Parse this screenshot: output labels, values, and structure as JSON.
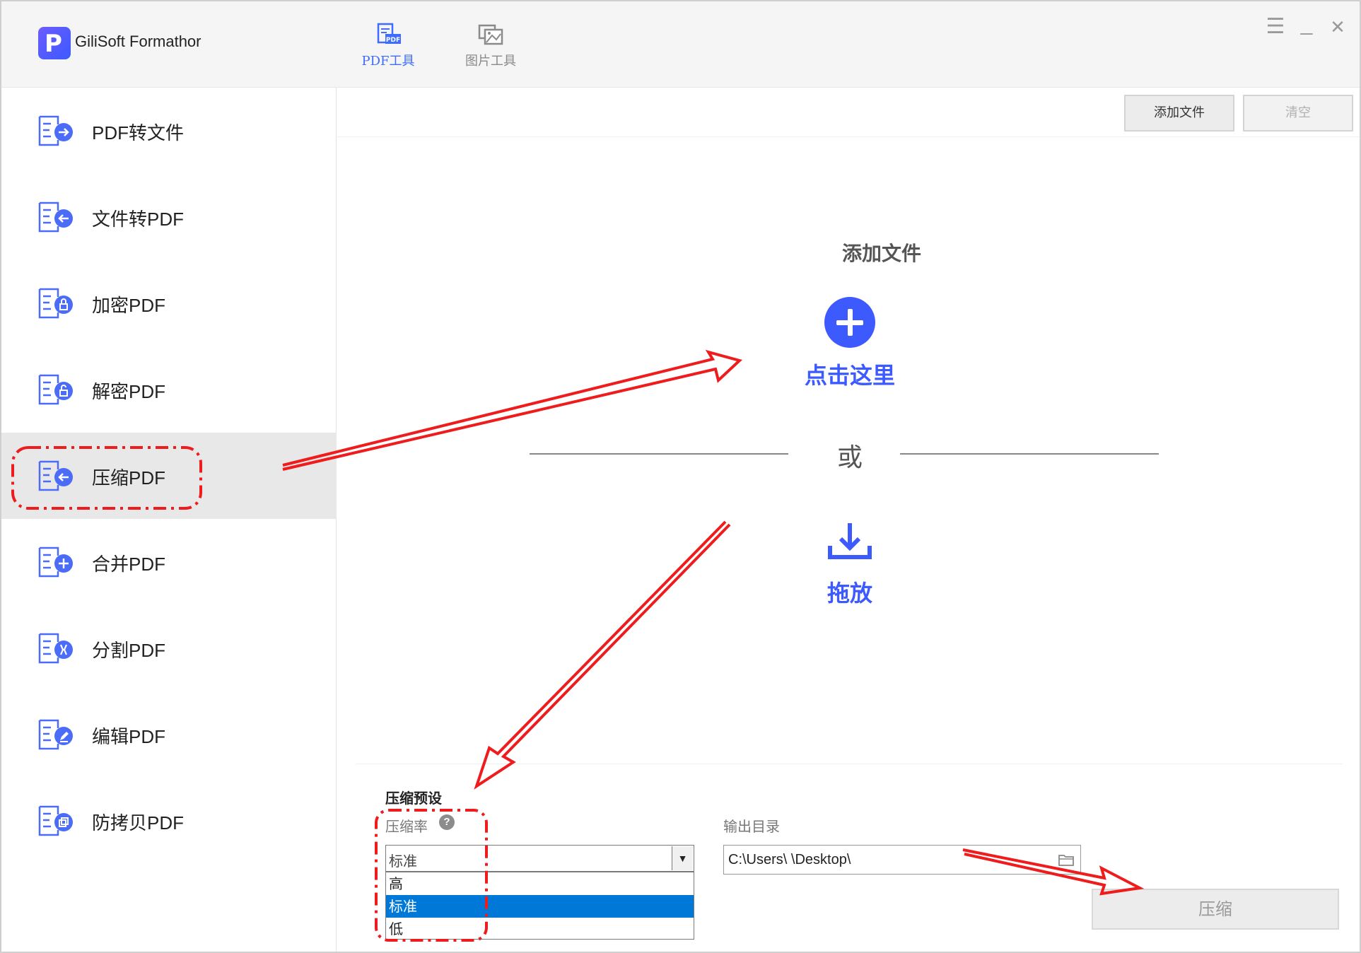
{
  "app": {
    "title": "GiliSoft Formathor",
    "logo_letter": "P"
  },
  "top_tabs": [
    {
      "label": "PDF工具",
      "icon": "pdf-tool-icon",
      "active": true
    },
    {
      "label": "图片工具",
      "icon": "image-tool-icon",
      "active": false
    }
  ],
  "window_controls": {
    "menu": "☰",
    "minimize": "_",
    "close": "✕"
  },
  "sidebar": {
    "items": [
      {
        "label": "PDF转文件",
        "icon": "pdf-to-file-icon"
      },
      {
        "label": "文件转PDF",
        "icon": "file-to-pdf-icon"
      },
      {
        "label": "加密PDF",
        "icon": "encrypt-pdf-icon"
      },
      {
        "label": "解密PDF",
        "icon": "decrypt-pdf-icon"
      },
      {
        "label": "压缩PDF",
        "icon": "compress-pdf-icon",
        "active": true
      },
      {
        "label": "合并PDF",
        "icon": "merge-pdf-icon"
      },
      {
        "label": "分割PDF",
        "icon": "split-pdf-icon"
      },
      {
        "label": "编辑PDF",
        "icon": "edit-pdf-icon"
      },
      {
        "label": "防拷贝PDF",
        "icon": "copy-protect-pdf-icon"
      }
    ]
  },
  "toolbar": {
    "add_file": "添加文件",
    "clear": "清空"
  },
  "dropzone": {
    "title": "添加文件",
    "click_here": "点击这里",
    "or": "或",
    "drag": "拖放"
  },
  "settings": {
    "preset_title": "压缩预设",
    "rate_label": "压缩率",
    "help": "?",
    "selected_rate": "标准",
    "rate_options": [
      "高",
      "标准",
      "低"
    ],
    "output_label": "输出目录",
    "output_path": "C:\\Users\\        \\Desktop\\",
    "compress_button": "压缩"
  },
  "colors": {
    "accent": "#3d5afe",
    "selected_option": "#0078d7",
    "annotation_red": "#ee1c1c"
  }
}
